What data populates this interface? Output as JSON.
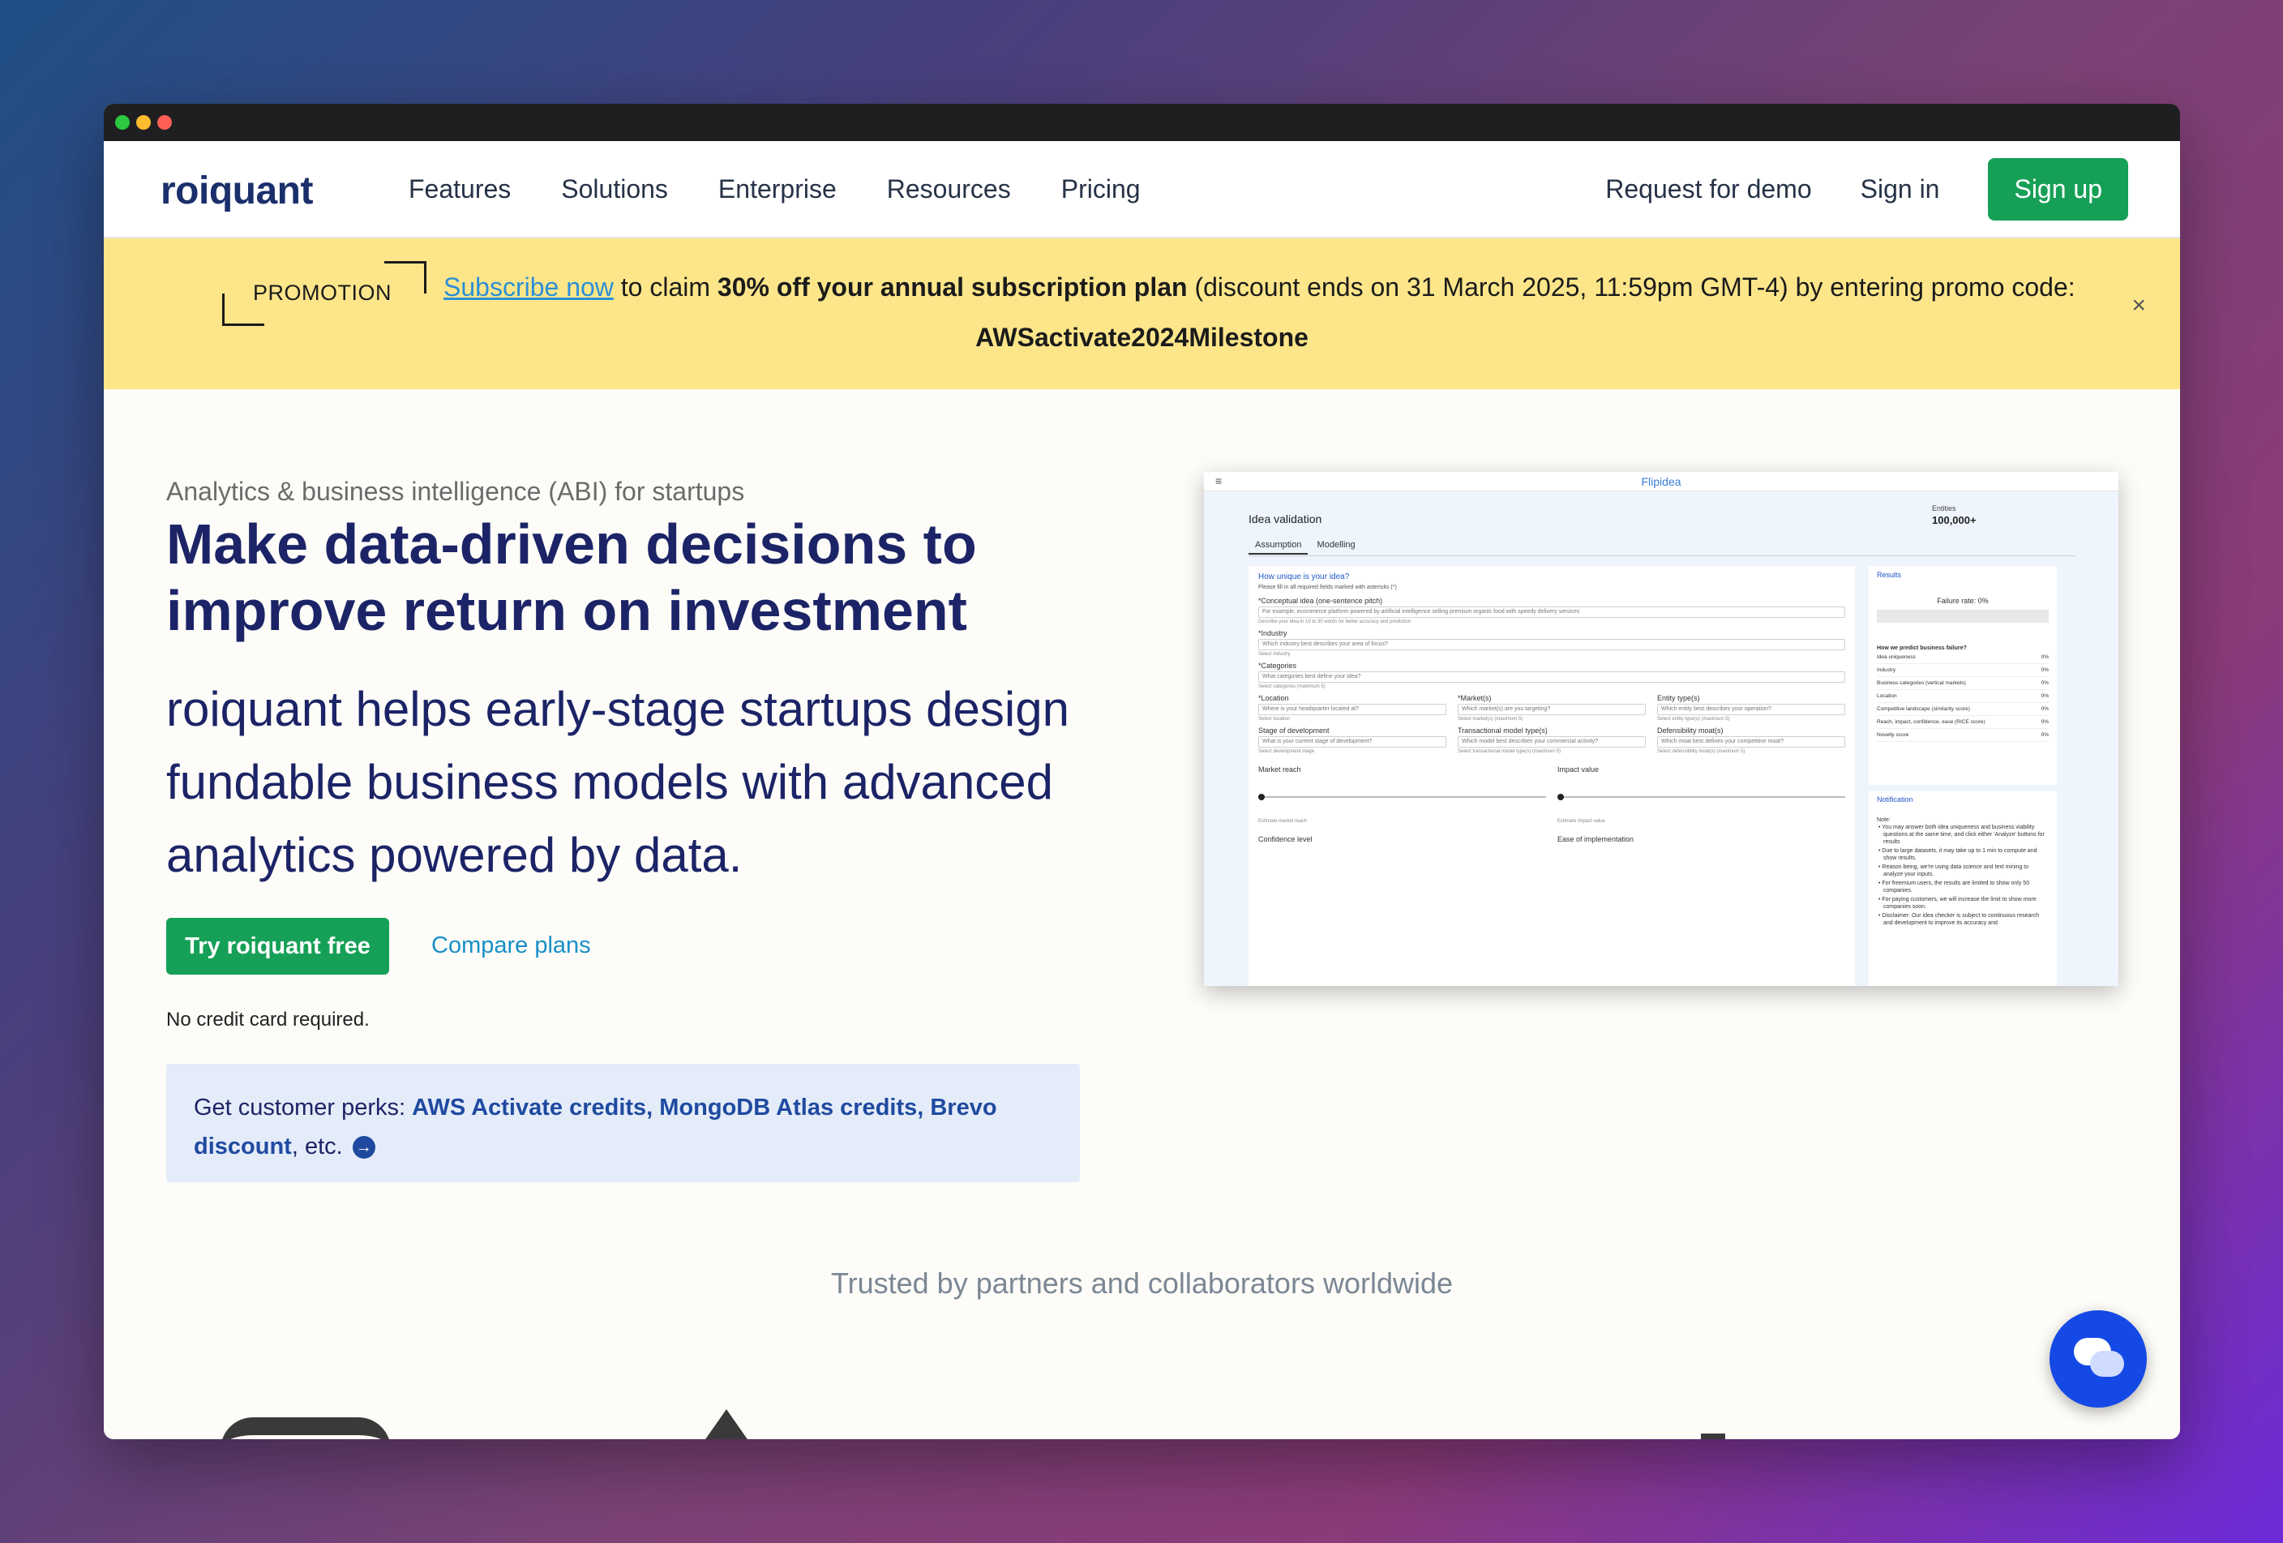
{
  "nav": {
    "logo": "roiquant",
    "links": [
      "Features",
      "Solutions",
      "Enterprise",
      "Resources",
      "Pricing"
    ],
    "request_demo": "Request for demo",
    "sign_in": "Sign in",
    "sign_up": "Sign up"
  },
  "promo": {
    "tag": "PROMOTION",
    "link_text": "Subscribe now",
    "text_1": " to claim ",
    "bold": "30% off your annual subscription plan",
    "text_2": " (discount ends on 31 March 2025, 11:59pm GMT-4) by entering promo code:",
    "code": "AWSactivate2024Milestone",
    "close": "×"
  },
  "hero": {
    "eyebrow": "Analytics & business intelligence (ABI) for startups",
    "title": "Make data-driven decisions to improve return on investment",
    "subtitle": "roiquant helps early-stage startups design fundable business models with advanced analytics powered by data.",
    "cta_primary": "Try roiquant free",
    "cta_secondary": "Compare plans",
    "note": "No credit card required.",
    "perks_prefix": "Get customer perks: ",
    "perks_bold": "AWS Activate credits, MongoDB Atlas credits, Brevo discount",
    "perks_suffix": ", etc.",
    "perks_arrow": "→"
  },
  "trusted": "Trusted by partners and collaborators worldwide",
  "screenshot": {
    "menu_icon": "≡",
    "brand": "Flipidea",
    "page_title": "Idea validation",
    "entities_label": "Entities",
    "entities_value": "100,000+",
    "tabs": [
      "Assumption",
      "Modelling"
    ],
    "section_title": "How unique is your idea?",
    "section_note": "Please fill in all required fields marked with asterisks (*)",
    "fields": {
      "concept_label": "*Conceptual idea (one-sentence pitch)",
      "concept_placeholder": "For example, ecommerce platform powered by artificial intelligence selling premium organic food with speedy delivery services",
      "concept_hint": "Describe your idea in 10 to 30 words for better accuracy and prediction",
      "industry_label": "*Industry",
      "industry_placeholder": "Which industry best describes your area of focus?",
      "industry_hint": "Select industry",
      "categories_label": "*Categories",
      "categories_placeholder": "What categories best define your idea?",
      "categories_hint": "Select categories (maximum 5)",
      "location_label": "*Location",
      "location_placeholder": "Where is your headquarter located at?",
      "location_hint": "Select location",
      "markets_label": "*Market(s)",
      "markets_placeholder": "Which market(s) are you targeting?",
      "markets_hint": "Select market(s) (maximum 5)",
      "entity_label": "Entity type(s)",
      "entity_placeholder": "Which entity best describes your operation?",
      "entity_hint": "Select entity type(s) (maximum 5)",
      "stage_label": "Stage of development",
      "stage_placeholder": "What is your current stage of development?",
      "stage_hint": "Select development stage",
      "model_label": "Transactional model type(s)",
      "model_placeholder": "Which model best describes your commercial activity?",
      "model_hint": "Select transactional model type(s) (maximum 5)",
      "defens_label": "Defensibility moat(s)",
      "defens_placeholder": "Which moat best defines your competitive moat?",
      "defens_hint": "Select defensibility moat(s) (maximum 5)",
      "reach_label": "Market reach",
      "reach_hint": "Estimate market reach",
      "impact_label": "Impact value",
      "impact_hint": "Estimate impact value",
      "confidence_label": "Confidence level",
      "ease_label": "Ease of implementation"
    },
    "results": {
      "title": "Results",
      "failure": "Failure rate: 0%",
      "question": "How we predict business failure?",
      "rows": [
        {
          "label": "Idea uniqueness",
          "value": "0%"
        },
        {
          "label": "Industry",
          "value": "0%"
        },
        {
          "label": "Business categories (vertical markets)",
          "value": "0%"
        },
        {
          "label": "Location",
          "value": "0%"
        },
        {
          "label": "Competitive landscape (similarity score)",
          "value": "0%"
        },
        {
          "label": "Reach, impact, confidence, ease (RICE score)",
          "value": "0%"
        },
        {
          "label": "Novelty score",
          "value": "0%"
        }
      ]
    },
    "notification": {
      "title": "Notification",
      "note": "Note:",
      "items": [
        "You may answer both idea uniqueness and business viability questions at the same time, and click either 'Analyze' buttons for results",
        "Due to large datasets, it may take up to 1 min to compute and show results.",
        "Reason being, we're using data science and text mining to analyze your inputs.",
        "For freemium users, the results are limited to show only 50 companies.",
        "For paying customers, we will increase the limit to show more companies soon.",
        "Disclaimer: Our idea checker is subject to continuous research and development to improve its accuracy and"
      ]
    }
  }
}
